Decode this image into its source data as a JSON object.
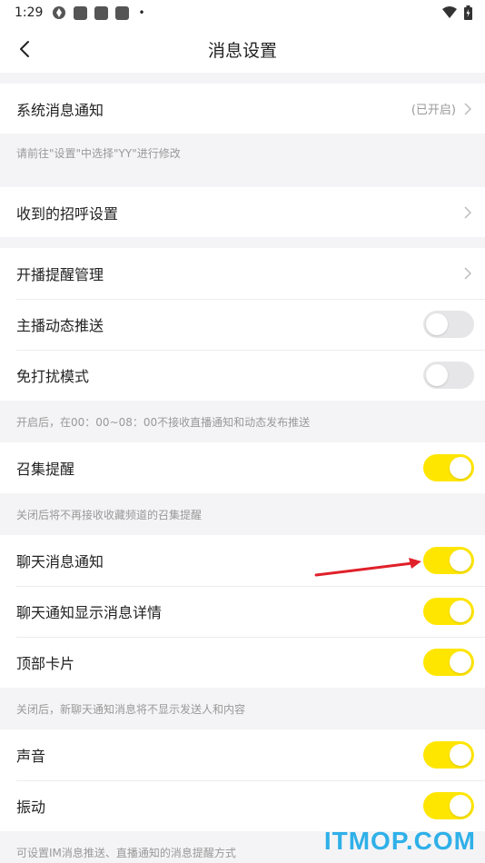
{
  "status_bar": {
    "time": "1:29"
  },
  "header": {
    "title": "消息设置"
  },
  "rows": {
    "system_notify": {
      "label": "系统消息通知",
      "value": "(已开启)"
    },
    "greeting": {
      "label": "收到的招呼设置"
    },
    "live_reminder": {
      "label": "开播提醒管理"
    },
    "anchor_feed": {
      "label": "主播动态推送"
    },
    "dnd": {
      "label": "免打扰模式"
    },
    "summon": {
      "label": "召集提醒"
    },
    "chat_notify": {
      "label": "聊天消息通知"
    },
    "chat_detail": {
      "label": "聊天通知显示消息详情"
    },
    "top_card": {
      "label": "顶部卡片"
    },
    "sound": {
      "label": "声音"
    },
    "vibrate": {
      "label": "振动"
    }
  },
  "toggles": {
    "anchor_feed": "off",
    "dnd": "off",
    "summon": "on",
    "chat_notify": "on",
    "chat_detail": "on",
    "top_card": "on",
    "sound": "on",
    "vibrate": "on"
  },
  "hints": {
    "system": "请前往\"设置\"中选择\"YY\"进行修改",
    "dnd": "开启后，在00：00~08：00不接收直播通知和动态发布推送",
    "summon": "关闭后将不再接收收藏频道的召集提醒",
    "chat": "关闭后，新聊天通知消息将不显示发送人和内容",
    "bottom": "可设置IM消息推送、直播通知的消息提醒方式"
  },
  "watermark": "ITMOP.COM",
  "colors": {
    "toggle_on": "#ffe600",
    "toggle_off": "#e6e6e8",
    "arrow": "#e0202a"
  }
}
